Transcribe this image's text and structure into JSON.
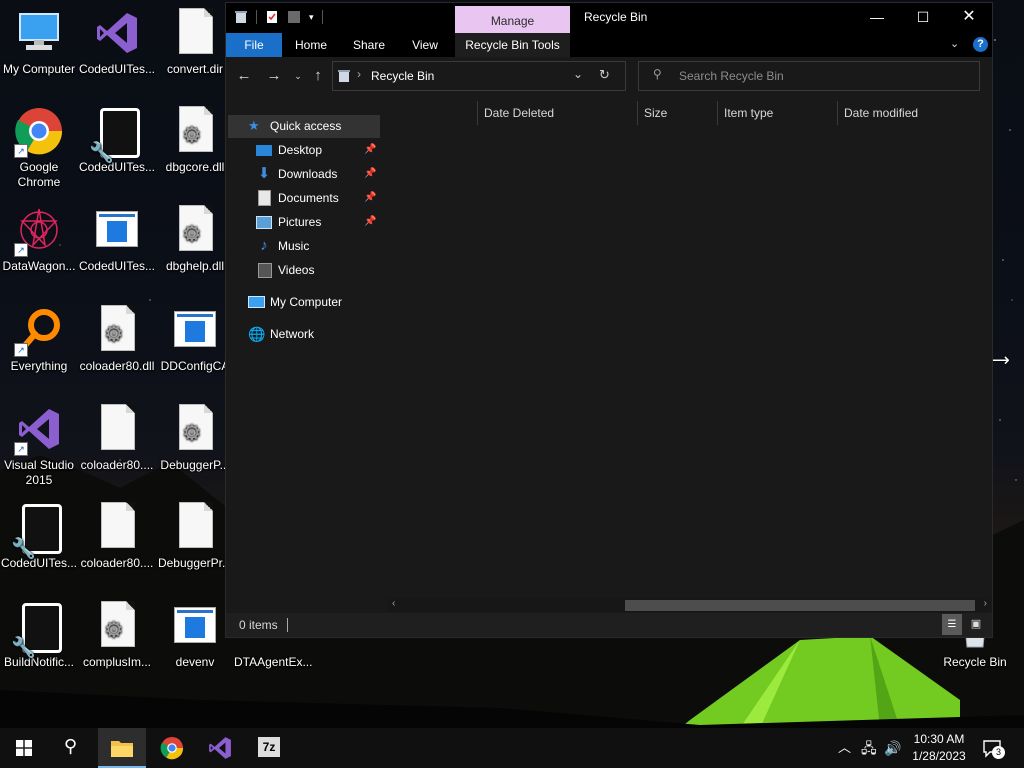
{
  "desktop": {
    "icons": [
      {
        "label": "My Computer"
      },
      {
        "label": "CodedUITes..."
      },
      {
        "label": "convert.dir"
      },
      {
        "label": "Google Chrome"
      },
      {
        "label": "CodedUITes..."
      },
      {
        "label": "dbgcore.dll"
      },
      {
        "label": "DataWagon..."
      },
      {
        "label": "CodedUITes..."
      },
      {
        "label": "dbghelp.dll"
      },
      {
        "label": "Everything"
      },
      {
        "label": "coloader80.dll"
      },
      {
        "label": "DDConfigCA"
      },
      {
        "label": "Visual Studio 2015"
      },
      {
        "label": "coloader80...."
      },
      {
        "label": "DebuggerP..."
      },
      {
        "label": "CodedUITes..."
      },
      {
        "label": "coloader80...."
      },
      {
        "label": "DebuggerPr..."
      },
      {
        "label": "BuildNotific..."
      },
      {
        "label": "complusIm..."
      },
      {
        "label": "devenv"
      },
      {
        "label": "DTAAgentEx..."
      },
      {
        "label": "Recycle Bin"
      }
    ]
  },
  "window": {
    "title": "Recycle Bin",
    "manage_tab": "Manage",
    "ribbon_tabs": {
      "file": "File",
      "home": "Home",
      "share": "Share",
      "view": "View",
      "tools": "Recycle Bin Tools"
    },
    "address": {
      "location": "Recycle Bin"
    },
    "search": {
      "placeholder": "Search Recycle Bin"
    },
    "nav": {
      "quick_access": "Quick access",
      "desktop": "Desktop",
      "downloads": "Downloads",
      "documents": "Documents",
      "pictures": "Pictures",
      "music": "Music",
      "videos": "Videos",
      "my_computer": "My Computer",
      "network": "Network"
    },
    "columns": {
      "date_deleted": "Date Deleted",
      "size": "Size",
      "item_type": "Item type",
      "date_modified": "Date modified"
    },
    "status": {
      "items": "0 items"
    }
  },
  "taskbar": {
    "time": "10:30 AM",
    "date": "1/28/2023",
    "notifications": "3"
  }
}
